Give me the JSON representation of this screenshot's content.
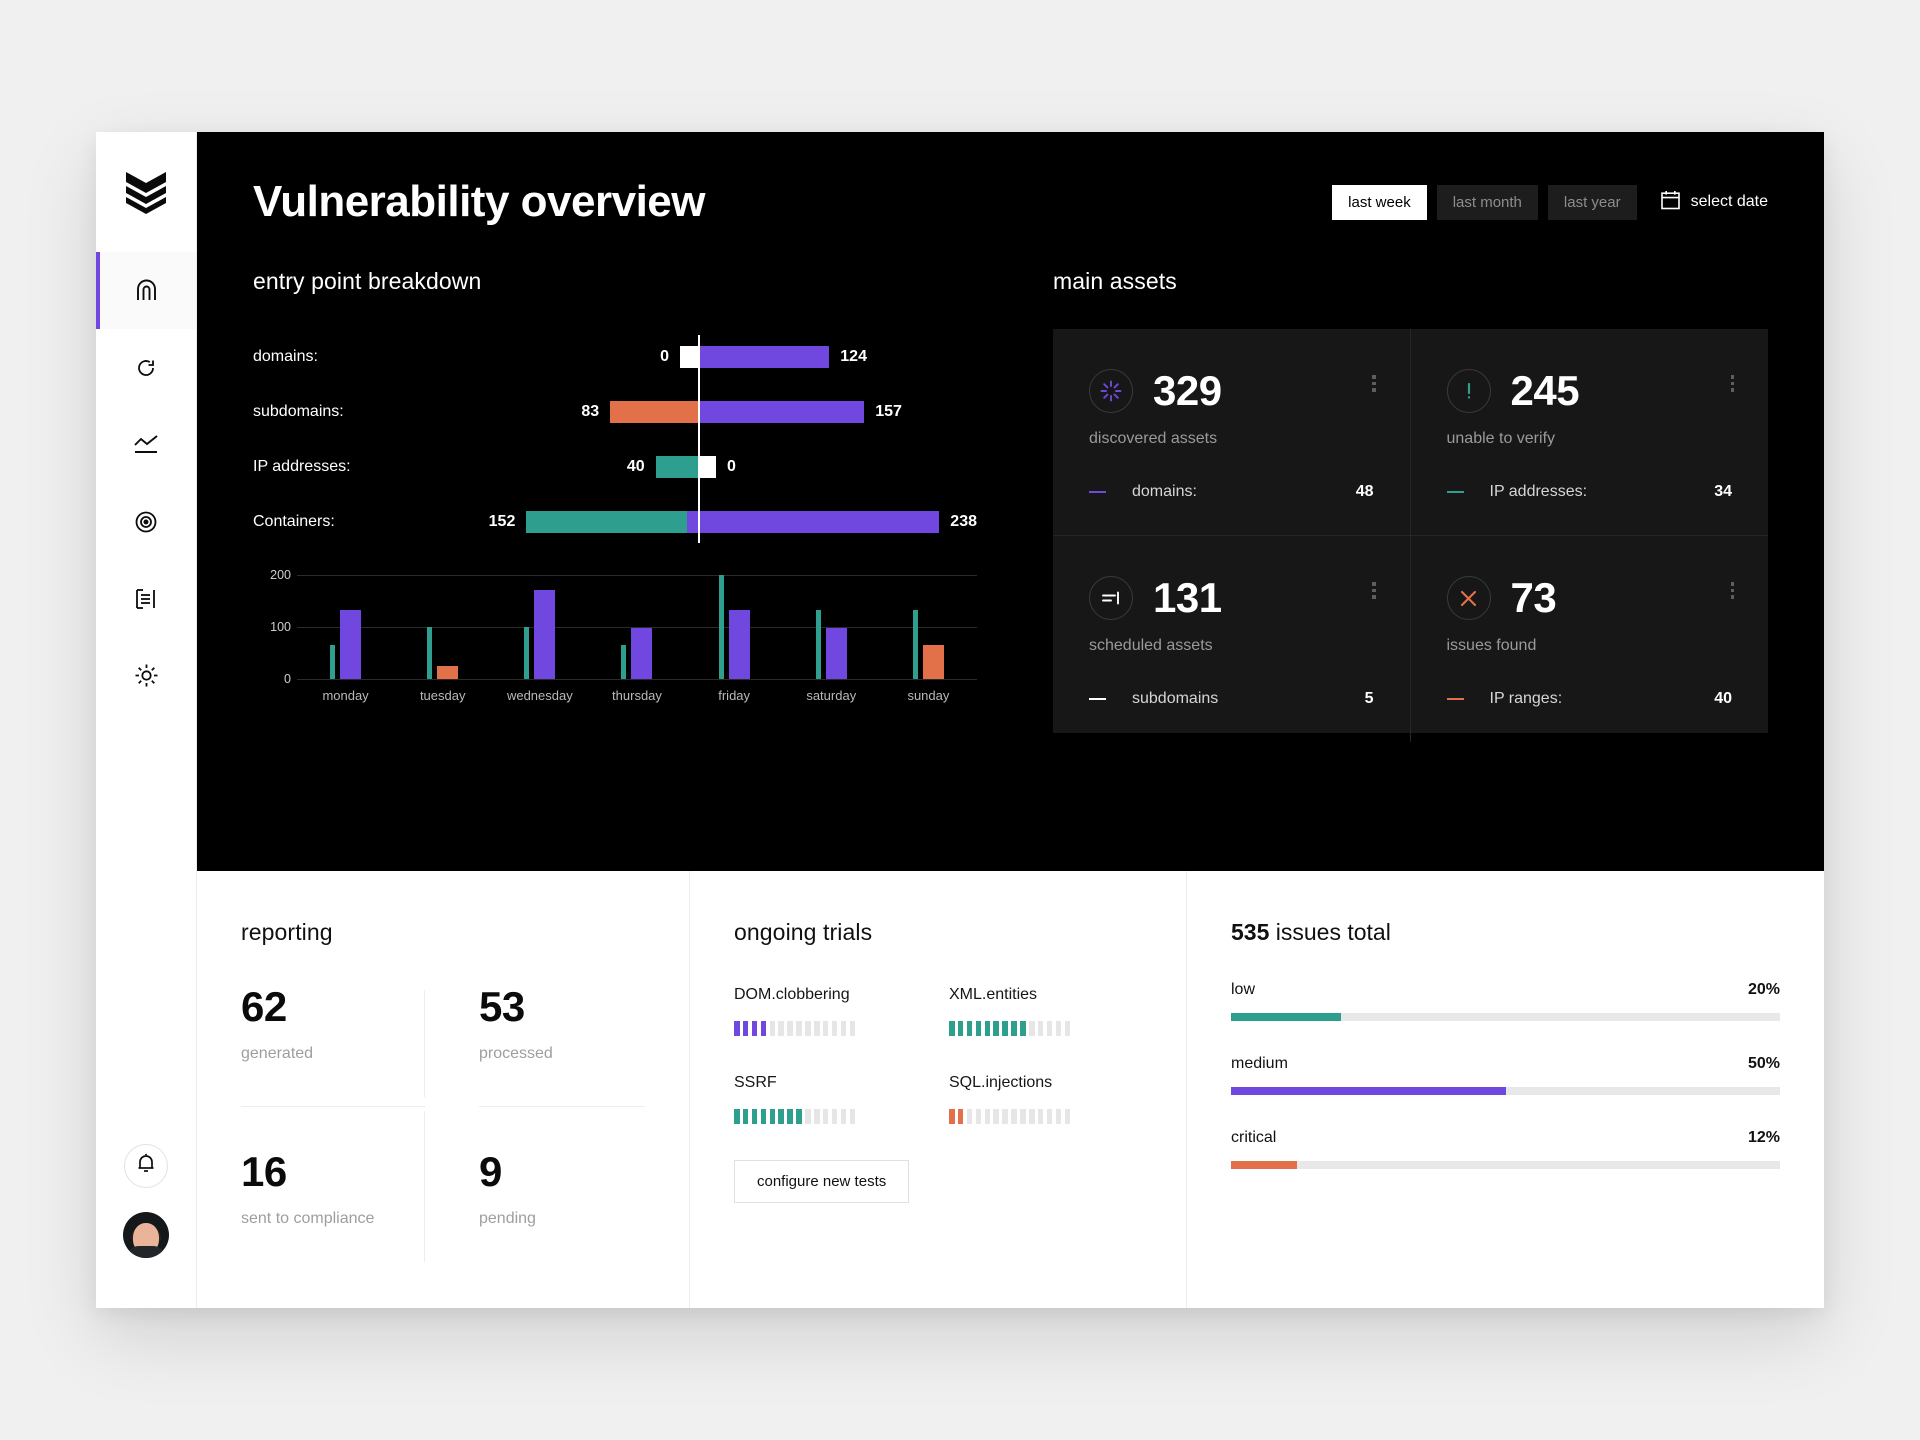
{
  "colors": {
    "purple": "#7048E0",
    "teal": "#2E9E8F",
    "orange": "#E2714A",
    "white": "#FFFFFF",
    "dark_bg": "#000000",
    "card_bg": "#171717",
    "track": "#E8E8E8"
  },
  "sidebar": {
    "logo_name": "chevron-stack-logo",
    "items": [
      {
        "icon": "arch-home-icon",
        "name": "sidebar-item-overview",
        "active": true
      },
      {
        "icon": "refresh-circle-icon",
        "name": "sidebar-item-scans",
        "active": false
      },
      {
        "icon": "line-chart-icon",
        "name": "sidebar-item-analytics",
        "active": false
      },
      {
        "icon": "target-icon",
        "name": "sidebar-item-targets",
        "active": false
      },
      {
        "icon": "list-document-icon",
        "name": "sidebar-item-reports",
        "active": false
      },
      {
        "icon": "gear-icon",
        "name": "sidebar-item-settings",
        "active": false
      }
    ],
    "bell_icon": "bell-icon",
    "avatar_name": "user-avatar"
  },
  "header": {
    "title": "Vulnerability overview",
    "filters": [
      {
        "label": "last week",
        "active": true
      },
      {
        "label": "last month",
        "active": false
      },
      {
        "label": "last year",
        "active": false
      }
    ],
    "select_date_label": "select date",
    "calendar_icon": "calendar-icon"
  },
  "entry_point": {
    "title": "entry point breakdown",
    "chart_data": {
      "type": "bar",
      "title": "entry point breakdown",
      "orientation": "horizontal-diverging",
      "categories": [
        "domains:",
        "subdomains:",
        "IP addresses:",
        "Containers:"
      ],
      "series": [
        {
          "name": "left",
          "values": [
            0,
            83,
            40,
            152
          ],
          "colors": [
            "#FFFFFF",
            "#E2714A",
            "#2E9E8F",
            "#2E9E8F"
          ]
        },
        {
          "name": "right",
          "values": [
            124,
            157,
            0,
            238
          ],
          "colors": [
            "#7048E0",
            "#7048E0",
            "#FFFFFF",
            "#7048E0"
          ]
        }
      ],
      "max": 238,
      "grid": false
    }
  },
  "week_chart": {
    "chart_data": {
      "type": "bar",
      "title": "",
      "categories": [
        "monday",
        "tuesday",
        "wednesday",
        "thursday",
        "friday",
        "saturday",
        "sunday"
      ],
      "yticks": [
        0,
        100,
        200
      ],
      "ylim": [
        0,
        200
      ],
      "series": [
        {
          "name": "scans",
          "color": "#2E9E8F",
          "values": [
            65,
            100,
            100,
            65,
            200,
            133,
            133
          ]
        },
        {
          "name": "findings",
          "values": [
            133,
            25,
            172,
            98,
            133,
            98,
            65
          ],
          "colors": [
            "#7048E0",
            "#E2714A",
            "#7048E0",
            "#7048E0",
            "#7048E0",
            "#7048E0",
            "#E2714A"
          ]
        }
      ],
      "grid": true
    }
  },
  "main_assets": {
    "title": "main assets",
    "cards": [
      {
        "icon": "burst-spinner-icon",
        "icon_color": "#7048E0",
        "value": "329",
        "caption": "discovered assets",
        "sub_label": "domains:",
        "sub_value": "48",
        "sub_color": "#7048E0",
        "menu_icon": "kebab-menu-icon"
      },
      {
        "icon": "exclamation-icon",
        "icon_color": "#2E9E8F",
        "value": "245",
        "caption": "unable to verify",
        "sub_label": "IP addresses:",
        "sub_value": "34",
        "sub_color": "#2E9E8F",
        "menu_icon": "kebab-menu-icon"
      },
      {
        "icon": "schedule-lines-icon",
        "icon_color": "#FFFFFF",
        "value": "131",
        "caption": "scheduled assets",
        "sub_label": "subdomains",
        "sub_value": "5",
        "sub_color": "#FFFFFF",
        "menu_icon": "kebab-menu-icon"
      },
      {
        "icon": "close-x-icon",
        "icon_color": "#E2714A",
        "value": "73",
        "caption": "issues found",
        "sub_label": "IP ranges:",
        "sub_value": "40",
        "sub_color": "#E2714A",
        "menu_icon": "kebab-menu-icon"
      }
    ]
  },
  "reporting": {
    "title": "reporting",
    "cells": [
      {
        "value": "62",
        "label": "generated"
      },
      {
        "value": "53",
        "label": "processed"
      },
      {
        "value": "16",
        "label": "sent to compliance"
      },
      {
        "value": "9",
        "label": "pending"
      }
    ]
  },
  "trials": {
    "title": "ongoing trials",
    "total_segments": 14,
    "items": [
      {
        "name": "DOM.clobbering",
        "filled": 4,
        "color": "#7048E0"
      },
      {
        "name": "XML.entities",
        "filled": 9,
        "color": "#2E9E8F"
      },
      {
        "name": "SSRF",
        "filled": 8,
        "color": "#2E9E8F"
      },
      {
        "name": "SQL.injections",
        "filled": 2,
        "color": "#E2714A"
      }
    ],
    "button_label": "configure new tests"
  },
  "issues": {
    "total": "535",
    "title_suffix": "issues total",
    "chart_data": {
      "type": "bar",
      "orientation": "horizontal",
      "title": "535 issues total",
      "categories": [
        "low",
        "medium",
        "critical"
      ],
      "values": [
        20,
        50,
        12
      ],
      "value_labels": [
        "20%",
        "50%",
        "12%"
      ],
      "colors": [
        "#2E9E8F",
        "#7048E0",
        "#E2714A"
      ],
      "ylim": [
        0,
        100
      ]
    }
  }
}
